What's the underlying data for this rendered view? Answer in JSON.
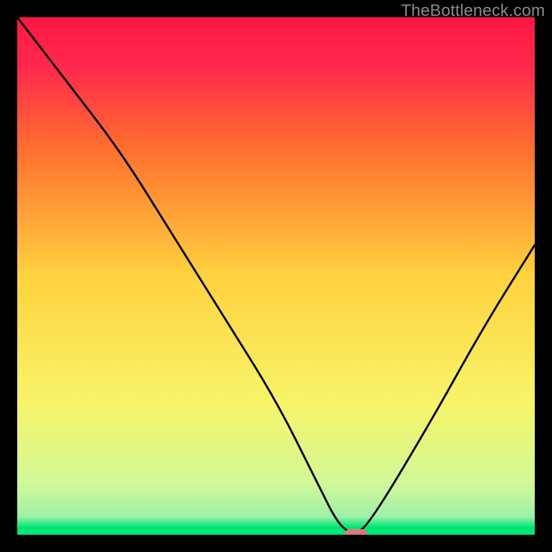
{
  "watermark": "TheBottleneck.com",
  "chart_data": {
    "type": "line",
    "title": "",
    "xlabel": "",
    "ylabel": "",
    "xlim": [
      0,
      100
    ],
    "ylim": [
      0,
      100
    ],
    "x": [
      0,
      10,
      20,
      30,
      40,
      50,
      58,
      62,
      65,
      68,
      80,
      90,
      100
    ],
    "values": [
      100,
      87,
      74,
      58,
      42,
      26,
      10,
      2,
      0,
      2,
      22,
      40,
      56
    ],
    "background_gradient": {
      "top": "#ff1744",
      "upper": "#ff6d2f",
      "mid": "#ffd23f",
      "lower": "#f7f56a",
      "pale": "#d2f898",
      "bottom": "#00e676"
    },
    "marker": {
      "x": 65.5,
      "y": 0.3,
      "w": 4.2,
      "h": 1.6,
      "color": "#d87a7a"
    },
    "line_color": "#000000",
    "frame_color": "#000000"
  }
}
